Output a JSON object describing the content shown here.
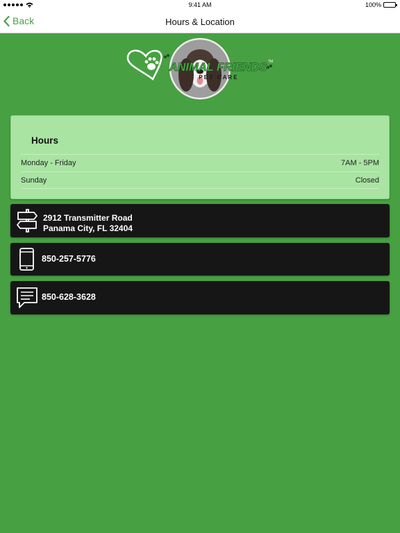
{
  "status_bar": {
    "time": "9:41 AM",
    "battery": "100%"
  },
  "nav": {
    "back_label": "Back",
    "title": "Hours & Location"
  },
  "logo": {
    "text": "ANIMAL FRIENDS",
    "tm": "TM",
    "subtext": "P E T   C A R E"
  },
  "hours": {
    "title": "Hours",
    "rows": [
      {
        "day": "Monday - Friday",
        "time": "7AM - 5PM"
      },
      {
        "day": "Sunday",
        "time": "Closed"
      }
    ]
  },
  "address": {
    "icon": "signpost-icon",
    "line1": "2912 Transmitter Road",
    "line2": "Panama City, FL 32404"
  },
  "phone": {
    "icon": "phone-icon",
    "number": "850-257-5776"
  },
  "sms": {
    "icon": "message-icon",
    "number": "850-628-3628"
  },
  "colors": {
    "background": "#47a041",
    "hours_card": "#a9e4a2",
    "info_card": "#161616",
    "accent": "#4aa04a"
  }
}
